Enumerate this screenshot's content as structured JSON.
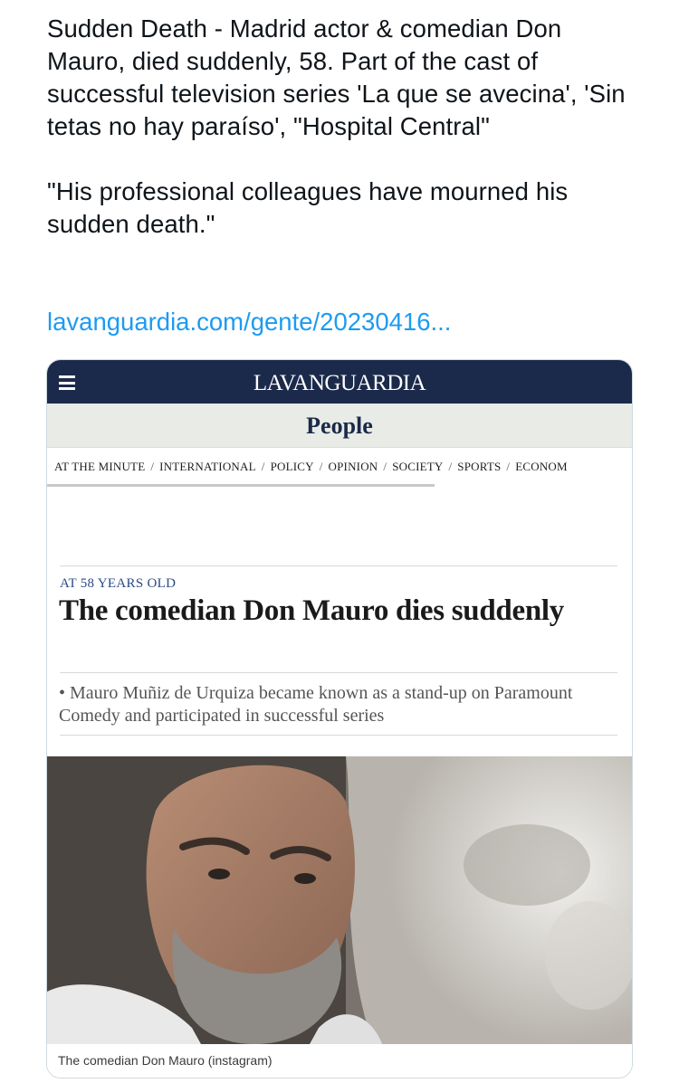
{
  "tweet": {
    "paragraph1": "Sudden Death - Madrid actor & comedian Don Mauro, died suddenly, 58. Part of the cast of successful television series 'La que se avecina', 'Sin tetas no hay paraíso', \"Hospital Central\"",
    "paragraph2": "\"His professional colleagues have mourned his sudden death.\"",
    "link": "lavanguardia.com/gente/20230416..."
  },
  "card": {
    "brand": "LAVANGUARDIA",
    "section": "People",
    "nav": [
      "AT THE MINUTE",
      "INTERNATIONAL",
      "POLICY",
      "OPINION",
      "SOCIETY",
      "SPORTS",
      "ECONOM"
    ],
    "nav_separator": "/",
    "kicker": "AT 58 YEARS OLD",
    "headline": "The comedian Don Mauro dies suddenly",
    "summary": "• Mauro Muñiz de Urquiza became known as a stand-up on Paramount Comedy and participated in successful series",
    "photo_caption": "The comedian Don Mauro (instagram)"
  },
  "colors": {
    "link": "#1d9bf0",
    "brand_bar": "#1b2a4a",
    "section_bar": "#e9ece6",
    "kicker": "#2b4a86"
  },
  "icons": {
    "menu": "hamburger-icon"
  }
}
